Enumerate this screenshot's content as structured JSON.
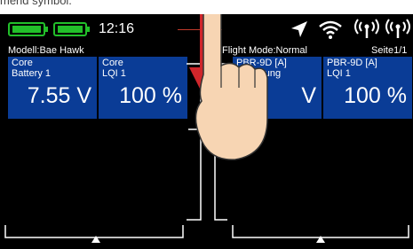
{
  "caption": "mend symbol.",
  "status": {
    "time": "12:16"
  },
  "header": {
    "model": "Modell:Bae Hawk",
    "flight_mode": "Flight Mode:Normal",
    "page": "Seite1/1"
  },
  "tiles": [
    {
      "line1": "Core",
      "line2": "Battery 1",
      "value": "7.55 V"
    },
    {
      "line1": "Core",
      "line2": "LQI 1",
      "value": "100 %"
    },
    {
      "line1": "PBR-9D [A]",
      "line2": "Spannung",
      "value": "V"
    },
    {
      "line1": "PBR-9D [A]",
      "line2": "LQI 1",
      "value": "100 %"
    }
  ],
  "icons": [
    "battery-icon",
    "battery-icon",
    "send-icon",
    "wifi-icon",
    "antenna-icon",
    "antenna-icon"
  ],
  "colors": {
    "screen_bg": "#000000",
    "tile_bg": "#0a3c96",
    "battery": "#22c02a",
    "arrow": "#d0262b",
    "hand": "#f7d5b3"
  }
}
